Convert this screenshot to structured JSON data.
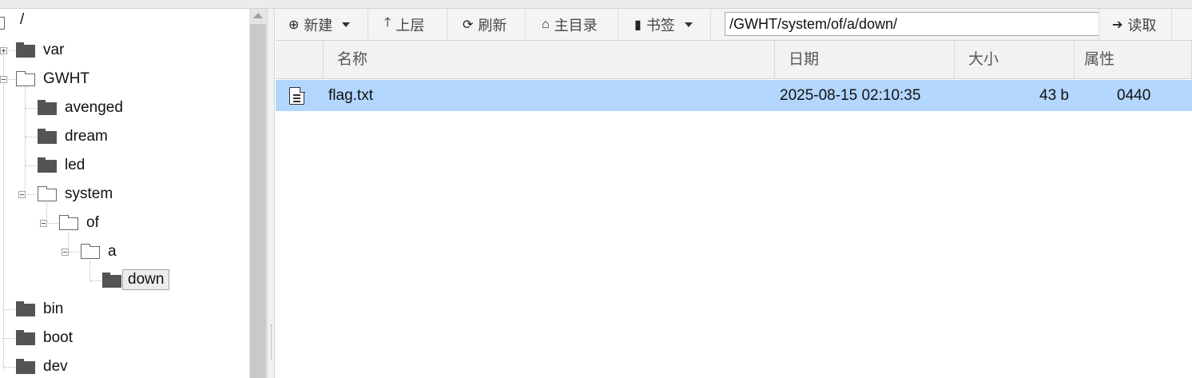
{
  "tree": {
    "root": "/",
    "items": [
      {
        "label": "var"
      },
      {
        "label": "GWHT"
      },
      {
        "label": "avenged"
      },
      {
        "label": "dream"
      },
      {
        "label": "led"
      },
      {
        "label": "system"
      },
      {
        "label": "of"
      },
      {
        "label": "a"
      },
      {
        "label": "down"
      },
      {
        "label": "bin"
      },
      {
        "label": "boot"
      },
      {
        "label": "dev"
      }
    ]
  },
  "toolbar": {
    "new_label": "新建",
    "up_label": "上层",
    "refresh_label": "刷新",
    "home_label": "主目录",
    "bookmark_label": "书签",
    "path_value": "/GWHT/system/of/a/down/",
    "read_label": "读取"
  },
  "table": {
    "columns": [
      "名称",
      "日期",
      "大小",
      "属性"
    ],
    "rows": [
      {
        "name": "flag.txt",
        "date": "2025-08-15 02:10:35",
        "size": "43 b",
        "attr": "0440"
      }
    ]
  },
  "colors": {
    "selection": "#b3d6ff",
    "toolbar_bg": "#f4f4f4"
  }
}
